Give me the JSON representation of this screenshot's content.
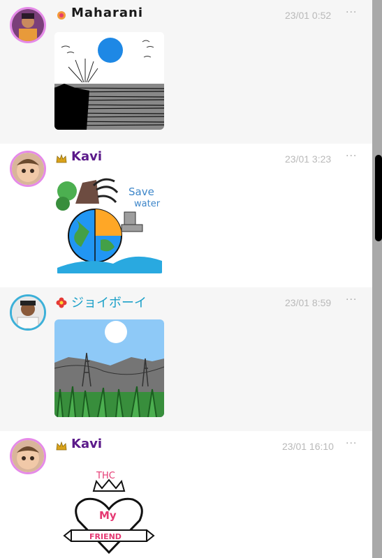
{
  "posts": [
    {
      "username": "Maharani",
      "timestamp": "23/01 0:52",
      "badge": "flower-badge",
      "name_color": "#1a1a1a",
      "more": "···"
    },
    {
      "username": "Kavi",
      "timestamp": "23/01 3:23",
      "badge": "crown-badge",
      "name_color": "#5b1a8a",
      "more": "···",
      "art_text": [
        "Save",
        "water"
      ]
    },
    {
      "username": "ジョイボーイ",
      "timestamp": "23/01 8:59",
      "badge": "red-flower-badge",
      "name_color": "#1aa0c8",
      "more": "···"
    },
    {
      "username": "Kavi",
      "timestamp": "23/01 16:10",
      "badge": "crown-badge",
      "name_color": "#5b1a8a",
      "more": "···",
      "art_text": [
        "THC",
        "My",
        "FRIEND"
      ]
    }
  ],
  "colors": {
    "scrollbar": "#a9a9a9",
    "thumb": "#000000",
    "time": "#b9b9b9"
  }
}
